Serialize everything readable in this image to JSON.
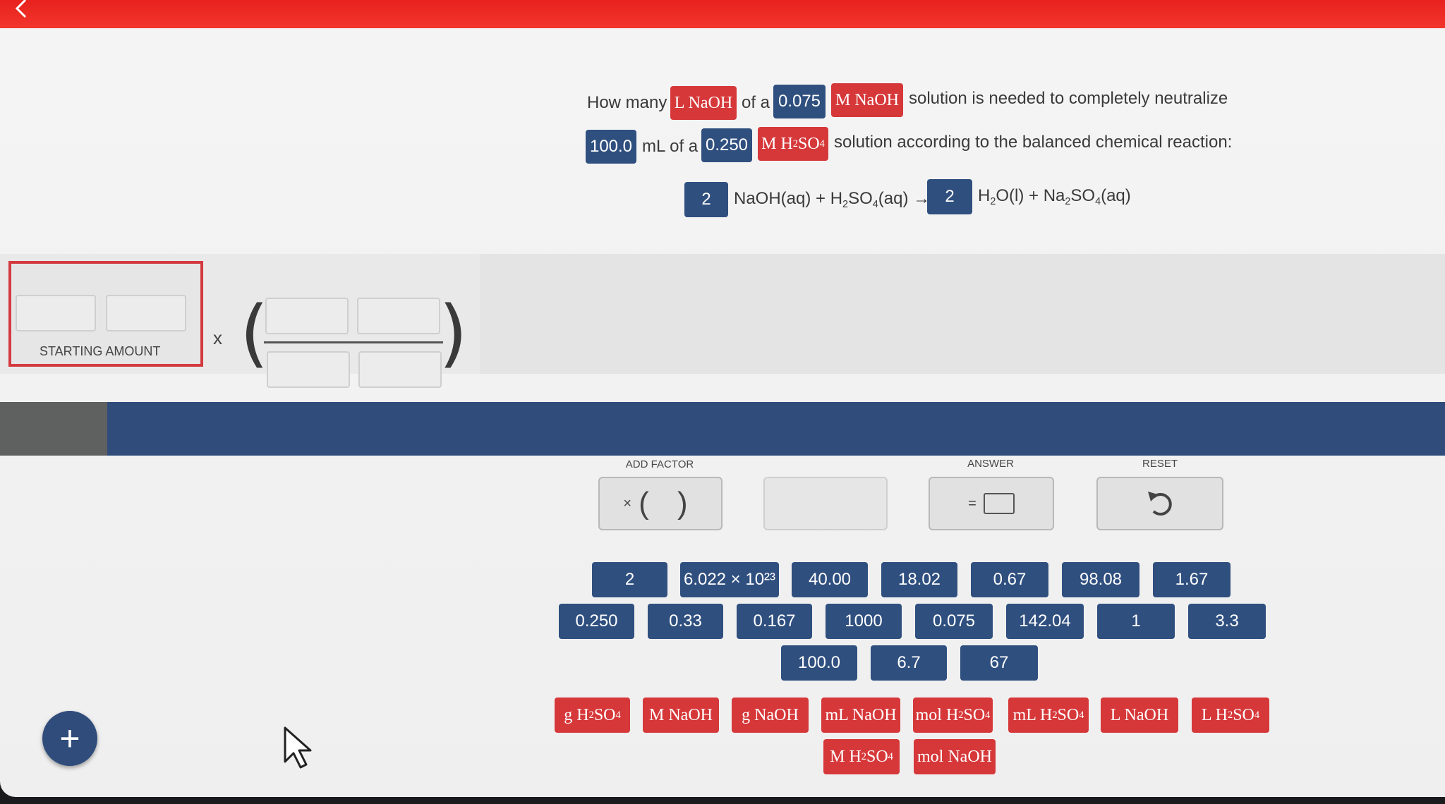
{
  "question": {
    "line1": {
      "text_a": "How many",
      "tag_unit": "L NaOH",
      "text_b": "of a",
      "tag_value": "0.075",
      "tag_conc": "M NaOH",
      "text_c": "solution is needed to completely neutralize"
    },
    "line2": {
      "tag_volume": "100.0",
      "text_a": "mL of a",
      "tag_value": "0.250",
      "tag_conc": "M H",
      "tag_conc_sub1": "2",
      "tag_conc_mid": "SO",
      "tag_conc_sub2": "4",
      "text_b": "solution according to the balanced chemical reaction:"
    },
    "equation": {
      "coef1": "2",
      "left_a": "NaOH(aq) + H",
      "left_sub1": "2",
      "left_b": "SO",
      "left_sub2": "4",
      "left_c": "(aq) →",
      "coef2": "2",
      "right_a": "H",
      "right_sub1": "2",
      "right_b": "O(l) + Na",
      "right_sub2": "2",
      "right_c": "SO",
      "right_sub3": "4",
      "right_d": "(aq)"
    }
  },
  "workspace": {
    "starting_amount_label": "STARTING AMOUNT",
    "times": "x",
    "paren_open": "(",
    "paren_close": ")"
  },
  "controls": {
    "add_factor_label": "ADD FACTOR",
    "add_factor_symbol": "×",
    "add_factor_parens": "( )",
    "answer_label": "ANSWER",
    "answer_equals": "=",
    "reset_label": "RESET",
    "reset_icon": "undo-icon"
  },
  "number_tiles": {
    "row1": [
      "2",
      "6.022 × 10²³",
      "40.00",
      "18.02",
      "0.67",
      "98.08",
      "1.67"
    ],
    "row2": [
      "0.250",
      "0.33",
      "0.167",
      "1000",
      "0.075",
      "142.04",
      "1",
      "3.3"
    ],
    "row3": [
      "100.0",
      "6.7",
      "67"
    ]
  },
  "unit_tiles": {
    "g_h2so4": [
      "g H",
      "2",
      "SO",
      "4"
    ],
    "m_naoh": "M NaOH",
    "g_naoh": "g NaOH",
    "ml_naoh": "mL NaOH",
    "mol_h2so4": [
      "mol H",
      "2",
      "SO",
      "4"
    ],
    "ml_h2so4": [
      "mL H",
      "2",
      "SO",
      "4"
    ],
    "l_naoh": "L NaOH",
    "l_h2so4": [
      "L H",
      "2",
      "SO",
      "4"
    ],
    "m_h2so4": [
      "M H",
      "2",
      "SO",
      "4"
    ],
    "mol_naoh": "mol NaOH"
  },
  "add_button": {
    "label": "+",
    "icon": "plus-icon"
  },
  "colors": {
    "red": "#d6383a",
    "blue": "#2f4f7f",
    "top_bar": "#ec2a24",
    "band": "#2f4c7b"
  }
}
